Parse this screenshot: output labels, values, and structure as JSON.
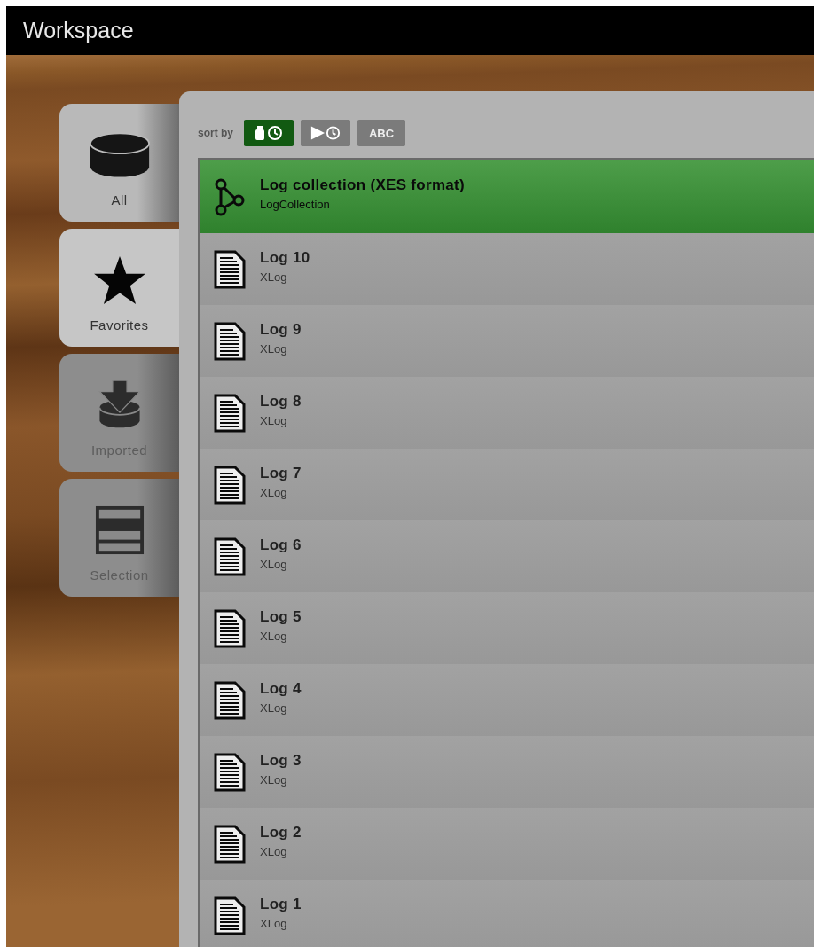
{
  "window": {
    "title": "Workspace"
  },
  "sidebar": {
    "items": [
      {
        "label": "All",
        "selected": false,
        "disabled": false
      },
      {
        "label": "Favorites",
        "selected": true,
        "disabled": false
      },
      {
        "label": "Imported",
        "selected": false,
        "disabled": true
      },
      {
        "label": "Selection",
        "selected": false,
        "disabled": true
      }
    ]
  },
  "sort": {
    "label": "sort by",
    "buttons": [
      {
        "kind": "created",
        "selected": true
      },
      {
        "kind": "accessed",
        "selected": false
      },
      {
        "kind": "name",
        "text": "ABC",
        "selected": false
      }
    ]
  },
  "list": {
    "items": [
      {
        "kind": "collection",
        "title": "Log collection (XES format)",
        "type": "LogCollection",
        "selected": true
      },
      {
        "kind": "log",
        "title": "Log 10",
        "type": "XLog",
        "selected": false
      },
      {
        "kind": "log",
        "title": "Log 9",
        "type": "XLog",
        "selected": false
      },
      {
        "kind": "log",
        "title": "Log 8",
        "type": "XLog",
        "selected": false
      },
      {
        "kind": "log",
        "title": "Log 7",
        "type": "XLog",
        "selected": false
      },
      {
        "kind": "log",
        "title": "Log 6",
        "type": "XLog",
        "selected": false
      },
      {
        "kind": "log",
        "title": "Log 5",
        "type": "XLog",
        "selected": false
      },
      {
        "kind": "log",
        "title": "Log 4",
        "type": "XLog",
        "selected": false
      },
      {
        "kind": "log",
        "title": "Log 3",
        "type": "XLog",
        "selected": false
      },
      {
        "kind": "log",
        "title": "Log 2",
        "type": "XLog",
        "selected": false
      },
      {
        "kind": "log",
        "title": "Log 1",
        "type": "XLog",
        "selected": false
      }
    ]
  }
}
